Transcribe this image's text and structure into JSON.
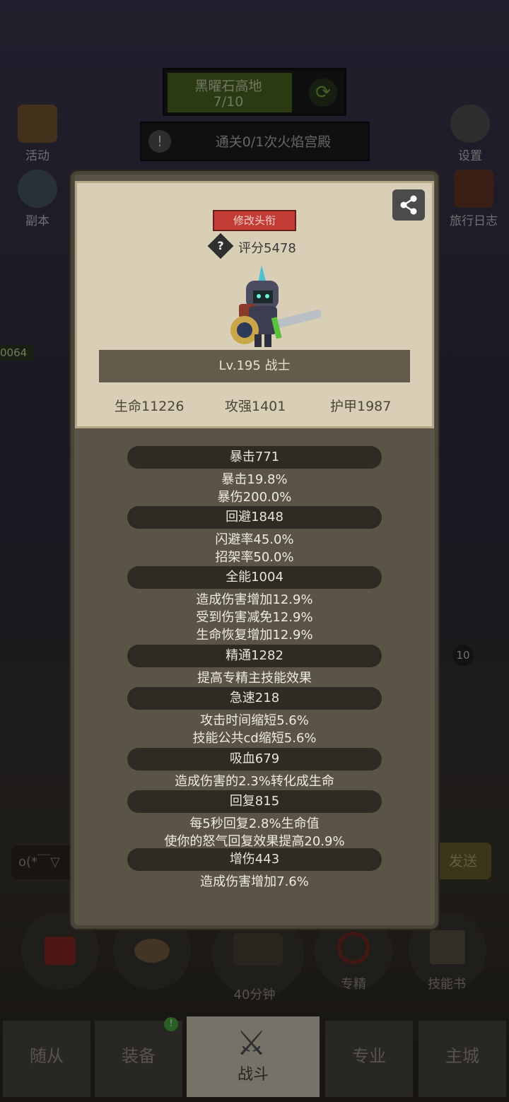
{
  "hud": {
    "zone_name": "黑曜石高地",
    "zone_progress": "7/10",
    "quest_text": "通关0/1次火焰宫殿",
    "left_buttons": [
      "活动",
      "副本"
    ],
    "right_buttons": [
      "设置",
      "旅行日志"
    ],
    "side_number": "0064"
  },
  "profile": {
    "change_title_label": "修改头衔",
    "score_label": "评分5478",
    "level_class": "Lv.195 战士",
    "hp": "生命11226",
    "attack": "攻强1401",
    "armor": "护甲1987"
  },
  "stats": [
    {
      "head": "暴击771",
      "lines": [
        "暴击19.8%",
        "暴伤200.0%"
      ]
    },
    {
      "head": "回避1848",
      "lines": [
        "闪避率45.0%",
        "招架率50.0%"
      ]
    },
    {
      "head": "全能1004",
      "lines": [
        "造成伤害增加12.9%",
        "受到伤害减免12.9%",
        "生命恢复增加12.9%"
      ]
    },
    {
      "head": "精通1282",
      "lines": [
        "提高专精主技能效果"
      ]
    },
    {
      "head": "急速218",
      "lines": [
        "攻击时间缩短5.6%",
        "技能公共cd缩短5.6%"
      ]
    },
    {
      "head": "吸血679",
      "lines": [
        "造成伤害的2.3%转化成生命"
      ]
    },
    {
      "head": "回复815",
      "lines": [
        "每5秒回复2.8%生命值",
        "使你的怒气回复效果提高20.9%"
      ]
    },
    {
      "head": "增伤443",
      "lines": [
        "造成伤害增加7.6%"
      ]
    }
  ],
  "bottom": {
    "chest_timer": "40分钟",
    "specialize_label": "专精",
    "skillbook_label": "技能书",
    "chat_placeholder": "o(*￣▽",
    "send_label": "发送",
    "side_badge": "10",
    "equip_badge": "!"
  },
  "nav": [
    "随从",
    "装备",
    "战斗",
    "专业",
    "主城"
  ]
}
